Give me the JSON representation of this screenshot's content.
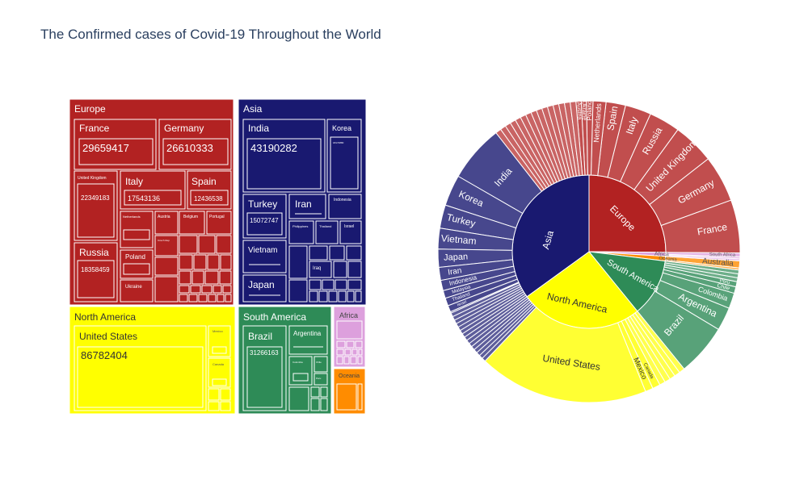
{
  "title": "The Confirmed cases of Covid-19 Throughout the World",
  "colors": {
    "Europe": "#b22222",
    "Asia": "#191970",
    "North America": "#ffff00",
    "South America": "#2e8b57",
    "Africa": "#dda0dd",
    "Oceania": "#ff8c00"
  },
  "chart_data": [
    {
      "type": "treemap",
      "continents": [
        {
          "name": "Europe",
          "countries": [
            {
              "name": "France",
              "value": 29659417
            },
            {
              "name": "Germany",
              "value": 26610333
            },
            {
              "name": "United Kingdom",
              "value": 22349183
            },
            {
              "name": "Italy",
              "value": 17543136
            },
            {
              "name": "Spain",
              "value": 12436538
            },
            {
              "name": "Russia",
              "value": 18358459
            }
          ]
        },
        {
          "name": "Asia",
          "countries": [
            {
              "name": "India",
              "value": 43190282
            },
            {
              "name": "Korea",
              "value": 0
            },
            {
              "name": "Turkey",
              "value": 15072747
            }
          ]
        },
        {
          "name": "North America",
          "countries": [
            {
              "name": "United States",
              "value": 86782404
            }
          ]
        },
        {
          "name": "South America",
          "countries": [
            {
              "name": "Brazil",
              "value": 31266163
            }
          ]
        },
        {
          "name": "Africa",
          "countries": []
        },
        {
          "name": "Oceania",
          "countries": []
        }
      ]
    },
    {
      "type": "sunburst",
      "inner_ring": [
        "Europe",
        "Asia",
        "North America",
        "South America",
        "Africa",
        "Oceania"
      ],
      "outer_labels": [
        "France",
        "Germany",
        "United Kingdom",
        "Russia",
        "Italy",
        "Spain",
        "Netherlands",
        "Poland",
        "Ukraine",
        "Austria",
        "India",
        "Korea",
        "Turkey",
        "Vietnam",
        "Japan",
        "Iran",
        "Indonesia",
        "Malaysia",
        "Thailand",
        "Israel",
        "Philippines",
        "Iraq",
        "United States",
        "Mexico",
        "Canada",
        "Brazil",
        "Argentina",
        "Colombia",
        "Chile",
        "Peru",
        "South Africa",
        "Australia"
      ]
    }
  ],
  "treemap_small_labels": {
    "germany_num": "26610333",
    "uk_num": "22349183",
    "italy_num": "17543136",
    "spain_num": "12436538",
    "russia_num": "18358459",
    "korea_num": "18174880",
    "netherlands": "Netherlands",
    "austria": "Austria",
    "belgium": "Belgium",
    "portugal": "Portugal",
    "poland": "Poland",
    "ukraine": "Ukraine",
    "czech": "Czech Rep",
    "indonesia": "Indonesia",
    "philippines": "Philippines",
    "thailand": "Thailand",
    "israel": "Israel",
    "iraq": "Iraq",
    "mexico": "Mexico",
    "canada": "Canada",
    "colombia": "Colombia",
    "chile": "Chile",
    "peru": "Peru",
    "argentina": "Argentina",
    "europe": "Europe",
    "asia": "Asia",
    "north_america": "North America",
    "south_america": "South America",
    "africa": "Africa",
    "oceania": "Oceania"
  }
}
